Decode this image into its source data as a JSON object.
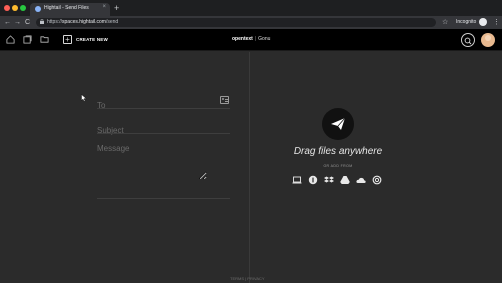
{
  "browser": {
    "tab": {
      "title": "Hightail - Send Files",
      "close": "×"
    },
    "new_tab": "+",
    "nav": {
      "back": "←",
      "forward": "→",
      "reload": "C"
    },
    "url_prefix": "https://",
    "url_host": "spaces.hightail.com",
    "url_path": "/send",
    "star": "☆",
    "profile_label": "Incognito",
    "menu": "⋮"
  },
  "app": {
    "header": {
      "create_new_label": "CREATE NEW",
      "brand_part1": "opentext",
      "brand_separator": "|",
      "brand_part2": "Gonu"
    },
    "compose": {
      "to_placeholder": "To",
      "subject_placeholder": "Subject",
      "message_placeholder": "Message"
    },
    "dropzone": {
      "title": "Drag files anywhere",
      "add_from": "OR ADD FROM",
      "sources": [
        "computer",
        "box",
        "dropbox",
        "google-drive",
        "onedrive",
        "creative-cloud"
      ]
    },
    "footer": {
      "terms": "TERMS",
      "sep": "|",
      "privacy": "PRIVACY"
    }
  },
  "colors": {
    "background": "#2b2b2b",
    "header": "#000000",
    "tab_active": "#35363a"
  }
}
